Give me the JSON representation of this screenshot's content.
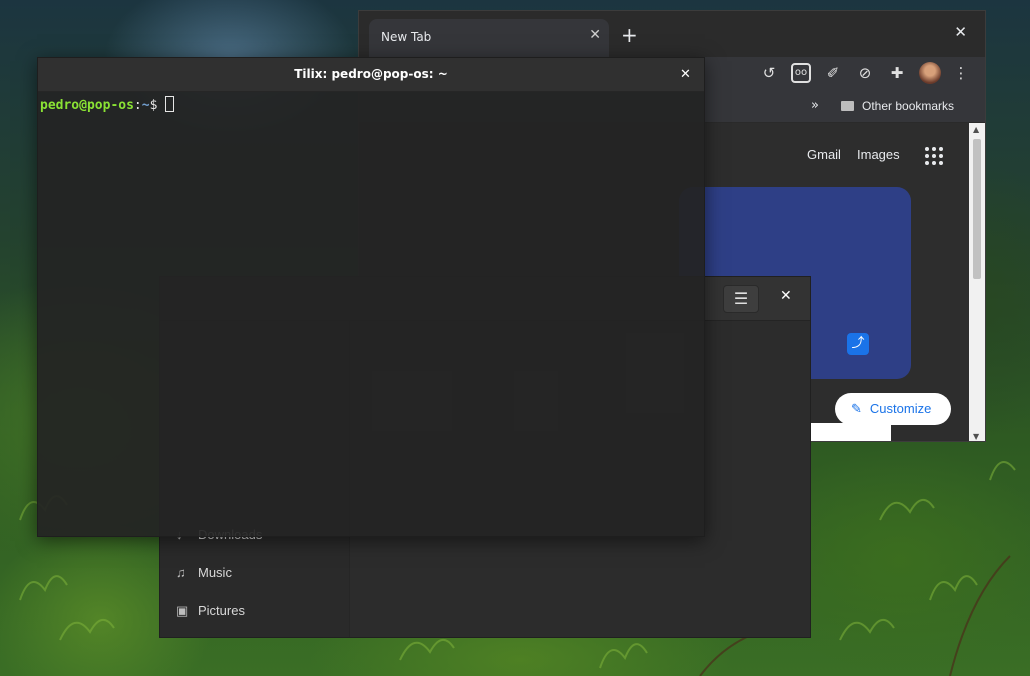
{
  "chrome": {
    "tab_title": "New Tab",
    "tab_close": "✕",
    "new_tab": "+",
    "window_close": "✕",
    "extensions": [
      "refresh-extension-icon",
      "ghostery-icon",
      "color-picker-icon",
      "block-icon",
      "puzzle-extension-icon",
      "profile-avatar",
      "menu-dots-icon"
    ],
    "bookmarks_more": "»",
    "other_bookmarks": "Other bookmarks",
    "gmail": "Gmail",
    "images": "Images",
    "customize": "Customize",
    "customize_icon": "✎"
  },
  "files": {
    "menu_icon": "☰",
    "close_icon": "✕",
    "sidebar": [
      {
        "label": "Downloads",
        "icon": "↓"
      },
      {
        "label": "Music",
        "icon": "♫"
      },
      {
        "label": "Pictures",
        "icon": "▣"
      }
    ]
  },
  "tilix": {
    "title": "Tilix: pedro@pop-os: ~",
    "close": "✕",
    "prompt_user": "pedro@pop-os",
    "prompt_colon": ":",
    "prompt_path": "~",
    "prompt_symbol": "$ "
  },
  "colors": {
    "accent": "#1a73e8",
    "prompt_user": "#8ae234",
    "prompt_path": "#729fcf"
  }
}
